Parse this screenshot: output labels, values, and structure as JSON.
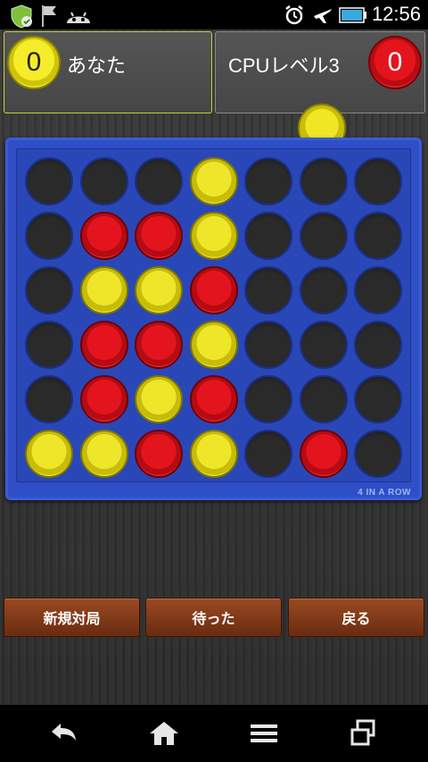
{
  "status_bar": {
    "left_icons": [
      "shield-check-icon",
      "flag-icon",
      "android-icon"
    ],
    "right_icons": [
      "alarm-icon",
      "airplane-mode-icon",
      "battery-icon"
    ],
    "time": "12:56"
  },
  "players": {
    "you": {
      "name": "あなた",
      "score": "0",
      "disc_color": "#f2e82a",
      "active": true
    },
    "cpu": {
      "name": "CPUレベル3",
      "score": "0",
      "disc_color": "#e3141d",
      "active": false
    }
  },
  "hover_disc": {
    "color": "yellow",
    "column": 6
  },
  "board": {
    "columns": 7,
    "rows": 6,
    "grid": [
      [
        "empty",
        "empty",
        "empty",
        "yellow",
        "empty",
        "empty",
        "empty"
      ],
      [
        "empty",
        "red",
        "red",
        "yellow",
        "empty",
        "empty",
        "empty"
      ],
      [
        "empty",
        "yellow",
        "yellow",
        "red",
        "empty",
        "empty",
        "empty"
      ],
      [
        "empty",
        "red",
        "red",
        "yellow",
        "empty",
        "empty",
        "empty"
      ],
      [
        "empty",
        "red",
        "yellow",
        "red",
        "empty",
        "empty",
        "empty"
      ],
      [
        "yellow",
        "yellow",
        "red",
        "yellow",
        "empty",
        "red",
        "empty"
      ]
    ],
    "brand": "4 IN A ROW",
    "colors": {
      "board": "#2f4fc6",
      "yellow": "#efe62a",
      "red": "#e3141d"
    }
  },
  "buttons": {
    "new_game": "新規対局",
    "undo": "待った",
    "back": "戻る"
  },
  "nav_bar": [
    "back-arrow-icon",
    "home-icon",
    "menu-icon",
    "recent-apps-icon"
  ]
}
